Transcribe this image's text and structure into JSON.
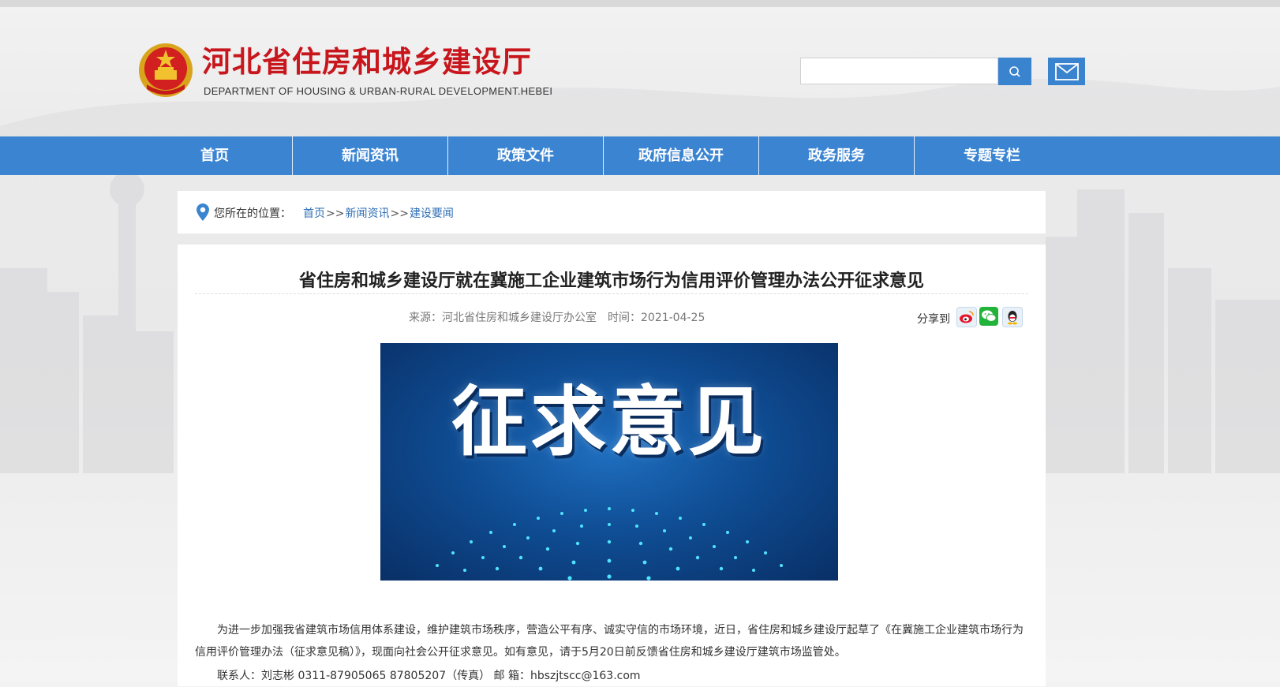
{
  "header": {
    "title_cn": "河北省住房和城乡建设厅",
    "title_en": "DEPARTMENT OF HOUSING & URBAN-RURAL DEVELOPMENT.HEBEI",
    "search_placeholder": ""
  },
  "nav": {
    "items": [
      "首页",
      "新闻资讯",
      "政策文件",
      "政府信息公开",
      "政务服务",
      "专题专栏"
    ]
  },
  "breadcrumb": {
    "label": "您所在的位置：",
    "items": [
      "首页",
      "新闻资讯",
      "建设要闻"
    ],
    "separator": ">>"
  },
  "article": {
    "title": "省住房和城乡建设厅就在冀施工企业建筑市场行为信用评价管理办法公开征求意见",
    "source": "来源：河北省住房和城乡建设厅办公室",
    "time": "时间：2021-04-25",
    "share_label": "分享到",
    "share_icons": [
      "weibo-icon",
      "wechat-icon",
      "qq-icon"
    ],
    "banner_text": "征求意见",
    "paragraph1": "为进一步加强我省建筑市场信用体系建设，维护建筑市场秩序，营造公平有序、诚实守信的市场环境，近日，省住房和城乡建设厅起草了《在冀施工企业建筑市场行为信用评价管理办法（征求意见稿）》，现面向社会公开征求意见。如有意见，请于5月20日前反馈省住房和城乡建设厅建筑市场监管处。",
    "contact": "联系人：刘志彬 0311-87905065 87805207（传真） 邮 箱：hbszjtscc@163.com"
  },
  "colors": {
    "brand_red": "#c8161d",
    "nav_blue": "#3b84d2",
    "link_blue": "#2f6fb5"
  }
}
